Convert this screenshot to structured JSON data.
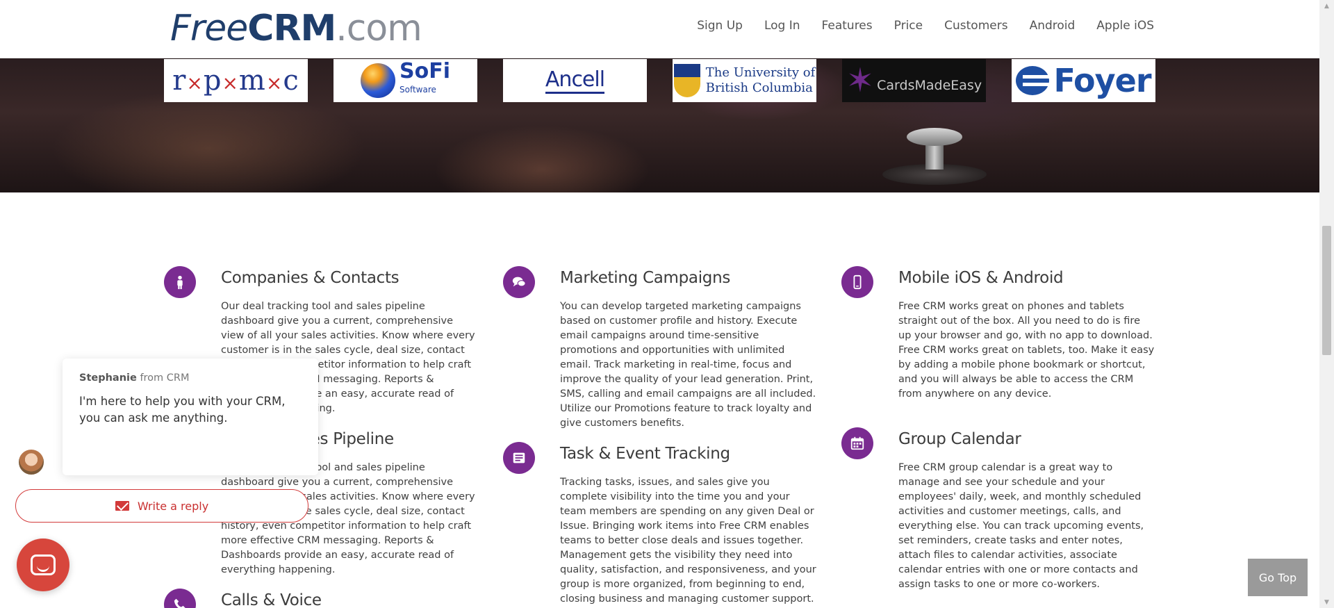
{
  "header": {
    "logo": {
      "part1": "Free",
      "part2": "CRM",
      "part3": ".com"
    },
    "nav": [
      {
        "label": "Sign Up"
      },
      {
        "label": "Log In"
      },
      {
        "label": "Features"
      },
      {
        "label": "Price"
      },
      {
        "label": "Customers"
      },
      {
        "label": "Android"
      },
      {
        "label": "Apple iOS"
      }
    ]
  },
  "clients": {
    "rpmc": {
      "r": "r",
      "p": "p",
      "m": "m",
      "c": "c",
      "sep": "×"
    },
    "sofi": {
      "name": "SoFi",
      "sub": "Software"
    },
    "ancell": {
      "name": "Ancell"
    },
    "ubc": {
      "mark": "UBC",
      "line1": "The University of",
      "line2": "British Columbia"
    },
    "cardsmadeeasy": {
      "name": "CardsMadeEasy"
    },
    "foyer": {
      "name": "Foyer"
    }
  },
  "features": [
    {
      "icon": "person-icon",
      "title": "Companies & Contacts",
      "body": "Our deal tracking tool and sales pipeline dashboard give you a current, comprehensive view of all your sales activities. Know where every customer is in the sales cycle, deal size, contact history, even competitor information to help craft more effective CRM messaging. Reports & Dashboards provide an easy, accurate read of everything happening."
    },
    {
      "icon": "chat-bubbles-icon",
      "title": "Marketing Campaigns",
      "body": "You can develop targeted marketing campaigns based on customer profile and history. Execute email campaigns around time-sensitive promotions and opportunities with unlimited email. Track marketing in real-time, focus and improve the quality of your lead generation. Print, SMS, calling and email campaigns are all included. Utilize our Promotions feature to track loyalty and give customers benefits."
    },
    {
      "icon": "mobile-phone-icon",
      "title": "Mobile iOS & Android",
      "body": "Free CRM works great on phones and tablets straight out of the box. All you need to do is fire up your browser and go, with no app to download. Free CRM works great on tablets, too. Make it easy by adding a mobile phone bookmark or shortcut, and you will always be able to access the CRM from anywhere on any device."
    },
    {
      "icon": "funnel-icon",
      "title": "Deals & Sales Pipeline",
      "body": "Our deal tracking tool and sales pipeline dashboard give you a current, comprehensive view of all your sales activities. Know where every customer is in the sales cycle, deal size, contact history, even competitor information to help craft more effective CRM messaging. Reports & Dashboards provide an easy, accurate read of everything happening."
    },
    {
      "icon": "task-list-icon",
      "title": "Task & Event Tracking",
      "body": "Tracking tasks, issues, and sales give you complete visibility into the time you and your team members are spending on any given Deal or Issue. Bringing work items into Free CRM enables teams to better close deals and issues together. Management gets the visibility they need into quality, satisfaction, and responsiveness, and your group is more organized, from beginning to end, closing business and managing customer support."
    },
    {
      "icon": "calendar-icon",
      "title": "Group Calendar",
      "body": "Free CRM group calendar is a great way to manage and see your schedule and your employees' daily, week, and monthly scheduled activities and customer meetings, calls, and everything else. You can track upcoming events, set reminders, create tasks and enter notes, attach files to calendar activities, associate calendar entries with one or more contacts and assign tasks to one or more co-workers."
    },
    {
      "icon": "phone-icon",
      "title": "Calls & Voice",
      "body": ""
    }
  ],
  "chat": {
    "sender": "Stephanie",
    "from_label": "from CRM",
    "message": "I'm here to help you with your CRM, you can ask me anything.",
    "reply_label": "Write a reply"
  },
  "go_top": {
    "label": "Go Top"
  },
  "colors": {
    "accent": "#7a2b91",
    "brand": "#1f3e6b",
    "chat_red": "#d7463c"
  }
}
